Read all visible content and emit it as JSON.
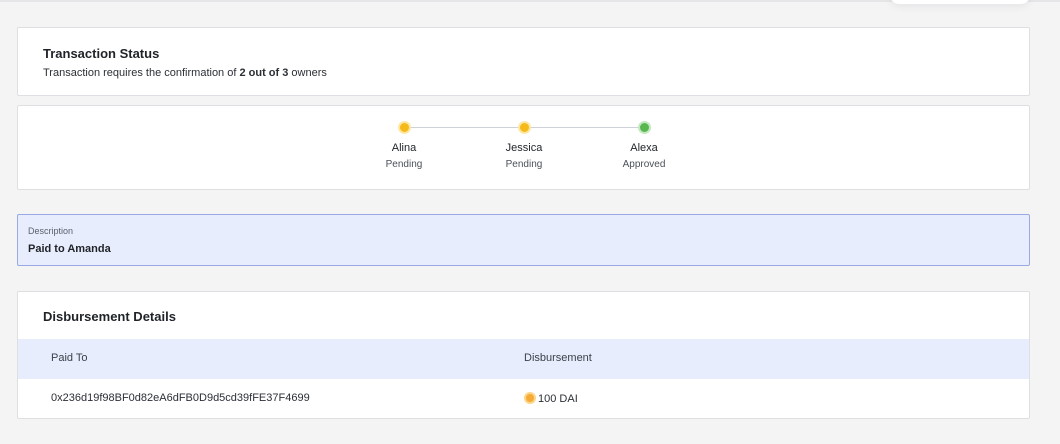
{
  "transaction_status": {
    "title": "Transaction Status",
    "subtitle_prefix": "Transaction requires the confirmation of ",
    "subtitle_bold": "2 out of 3",
    "subtitle_suffix": " owners"
  },
  "owners": [
    {
      "name": "Alina",
      "status": "Pending"
    },
    {
      "name": "Jessica",
      "status": "Pending"
    },
    {
      "name": "Alexa",
      "status": "Approved"
    }
  ],
  "description": {
    "label": "Description",
    "value": "Paid to Amanda"
  },
  "disbursement": {
    "title": "Disbursement Details",
    "columns": [
      "Paid To",
      "Disbursement"
    ],
    "rows": [
      {
        "paid_to": "0x236d19f98BF0d82eA6dFB0D9d5cd39fFE37F4699",
        "amount": "100 DAI",
        "token_icon": "dai-coin-icon"
      }
    ]
  },
  "colors": {
    "pending": "#f6b91a",
    "approved": "#58b84f",
    "highlight_bg": "#e7edfc",
    "highlight_border": "#9aa9e4"
  }
}
